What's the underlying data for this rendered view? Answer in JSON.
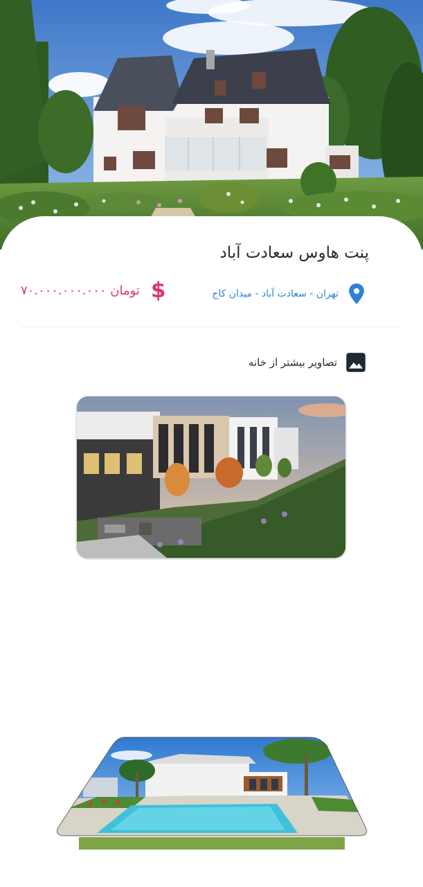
{
  "property": {
    "title": "پنت هاوس سعادت آباد",
    "location": "تهران - سعادت آباد - میدان کاج",
    "price": "۷۰.۰۰۰.۰۰۰.۰۰۰ تومان",
    "currency_symbol": "$"
  },
  "gallery": {
    "label": "تصاویر بیشتر از خانه",
    "icon": "image-icon"
  },
  "icons": {
    "location": "location-pin-icon",
    "price": "dollar-icon"
  },
  "colors": {
    "price_accent": "#e0356b",
    "location_accent": "#2f80d8",
    "title_text": "#2b2b2b"
  }
}
